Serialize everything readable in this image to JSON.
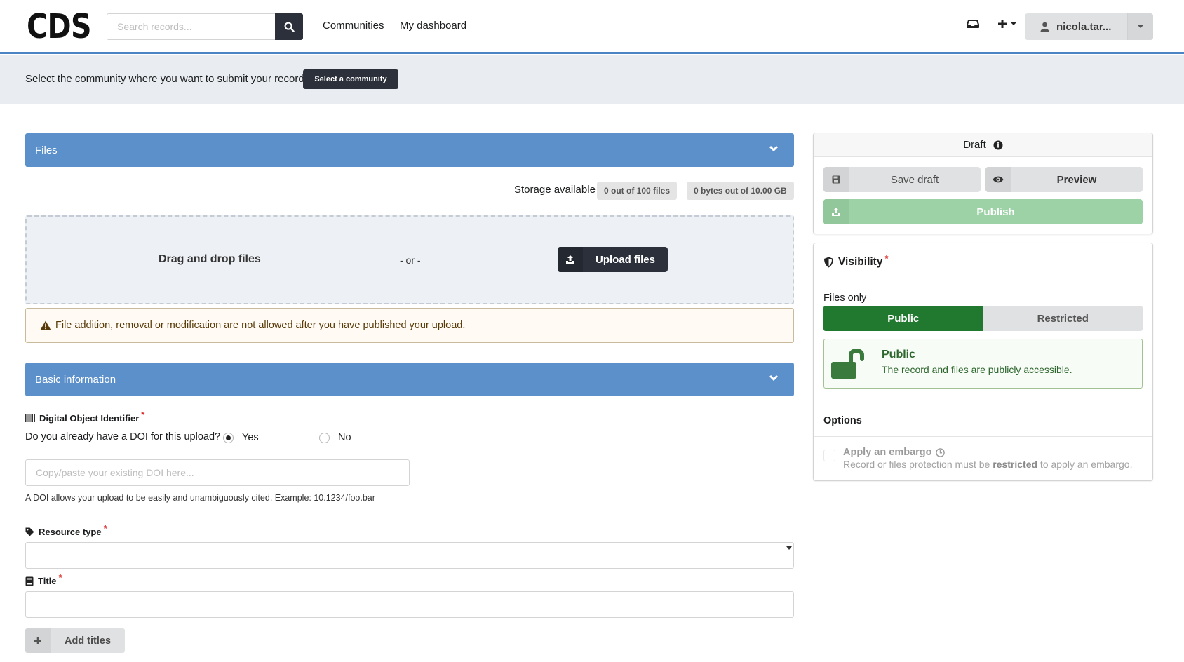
{
  "header": {
    "logo": "CDS",
    "search_placeholder": "Search records...",
    "nav": [
      "Communities",
      "My dashboard"
    ],
    "user": "nicola.tar..."
  },
  "banner": {
    "text": "Select the community where you want to submit your record.",
    "button": "Select a community"
  },
  "files_section": {
    "title": "Files",
    "storage_label": "Storage available",
    "files_count": "0 out of 100 files",
    "bytes_used": "0 bytes out of 10.00 GB",
    "dropzone_text": "Drag and drop files",
    "or_text": "- or -",
    "upload_button": "Upload files",
    "warning": "File addition, removal or modification are not allowed after you have published your upload."
  },
  "basic_section": {
    "title": "Basic information",
    "doi": {
      "label": "Digital Object Identifier",
      "question": "Do you already have a DOI for this upload?",
      "options": [
        "Yes",
        "No"
      ],
      "selected": "Yes",
      "placeholder": "Copy/paste your existing DOI here...",
      "help": "A DOI allows your upload to be easily and unambiguously cited. Example: 10.1234/foo.bar"
    },
    "resource_type_label": "Resource type",
    "title_label": "Title",
    "add_titles_button": "Add titles"
  },
  "sidebar": {
    "status": "Draft",
    "save_draft": "Save draft",
    "preview": "Preview",
    "publish": "Publish",
    "visibility": {
      "title": "Visibility",
      "files_only": "Files only",
      "options": [
        "Public",
        "Restricted"
      ],
      "selected": "Public",
      "box_title": "Public",
      "box_desc": "The record and files are publicly accessible."
    },
    "options": {
      "title": "Options",
      "embargo_title": "Apply an embargo",
      "embargo_desc_pre": "Record or files protection must be",
      "embargo_desc_bold": "restricted",
      "embargo_desc_post": "to apply an embargo."
    }
  },
  "colors": {
    "accent": "#5b90cb",
    "dark_button": "#2b303b",
    "public_green": "#21792f",
    "publish_green": "#9dd1a6"
  }
}
